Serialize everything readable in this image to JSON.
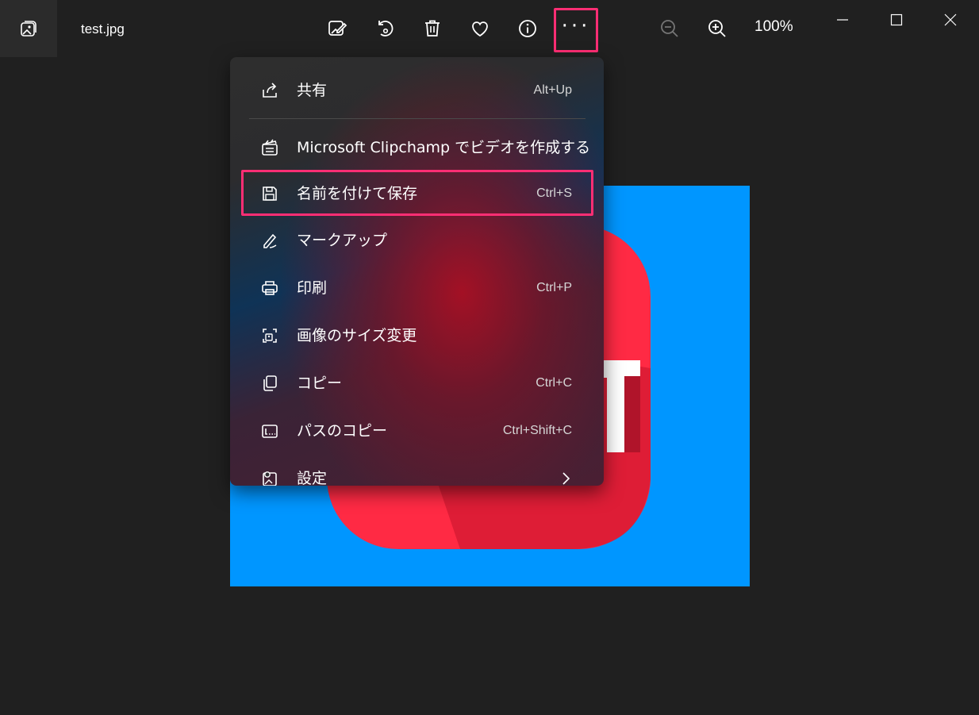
{
  "titlebar": {
    "file_name": "test.jpg",
    "zoom_level": "100%"
  },
  "toolbar": {
    "tools": [
      {
        "icon": "edit-image-icon"
      },
      {
        "icon": "rotate-icon"
      },
      {
        "icon": "delete-icon"
      },
      {
        "icon": "favorite-heart-icon"
      },
      {
        "icon": "info-icon"
      },
      {
        "icon": "more-options-icon"
      }
    ],
    "more_label": "···"
  },
  "menu": {
    "items": [
      {
        "label": "共有",
        "shortcut": "Alt+Up",
        "icon": "share-icon"
      },
      {
        "label": "Microsoft Clipchamp でビデオを作成する",
        "shortcut": "",
        "icon": "clipchamp-icon"
      },
      {
        "label": "名前を付けて保存",
        "shortcut": "Ctrl+S",
        "icon": "save-icon"
      },
      {
        "label": "マークアップ",
        "shortcut": "",
        "icon": "markup-pen-icon"
      },
      {
        "label": "印刷",
        "shortcut": "Ctrl+P",
        "icon": "print-icon"
      },
      {
        "label": "画像のサイズ変更",
        "shortcut": "",
        "icon": "resize-image-icon"
      },
      {
        "label": "コピー",
        "shortcut": "Ctrl+C",
        "icon": "copy-icon"
      },
      {
        "label": "パスのコピー",
        "shortcut": "Ctrl+Shift+C",
        "icon": "copy-path-icon"
      },
      {
        "label": "設定",
        "shortcut": "",
        "icon": "settings-icon"
      }
    ]
  },
  "colors": {
    "accent_highlight": "#ff2e74",
    "background": "#202020",
    "photo_background": "#0096ff",
    "photo_logo": "#ff2a44"
  }
}
